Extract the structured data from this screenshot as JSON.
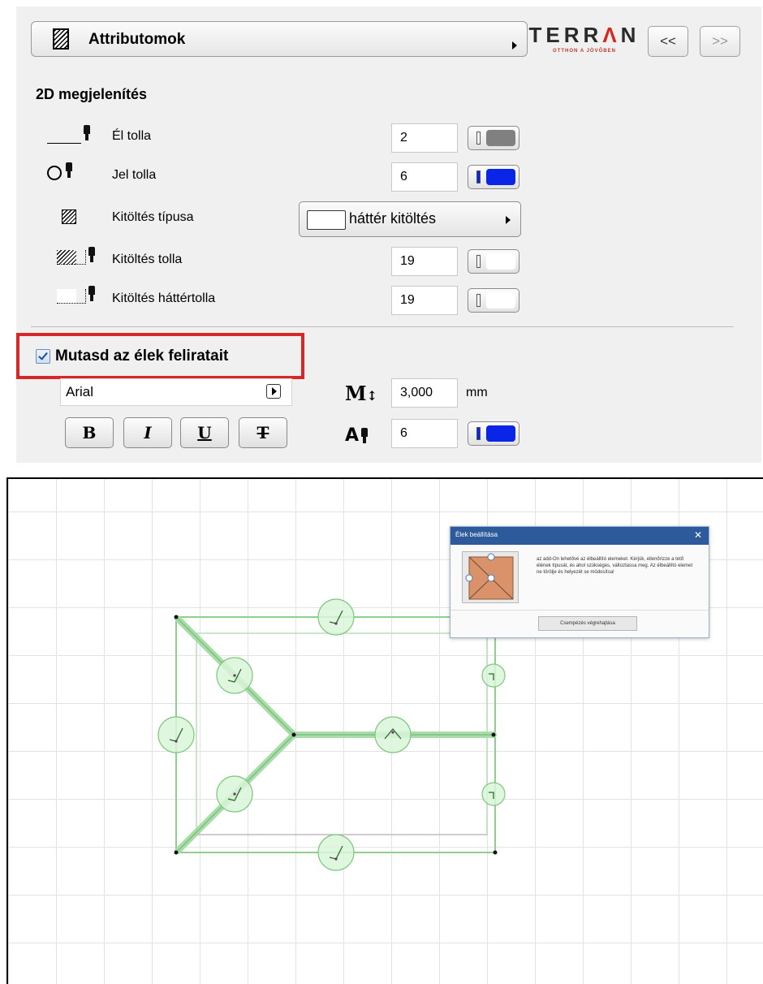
{
  "header": {
    "title": "Attributomok",
    "logo_text": "TERRAN",
    "logo_tagline": "OTTHON A JÖVŐBEN",
    "prev_label": "<<",
    "next_label": ">>"
  },
  "section_2d": {
    "title": "2D megjelenítés",
    "rows": [
      {
        "label": "Él tolla",
        "value": "2",
        "pen_color": "#808080"
      },
      {
        "label": "Jel tolla",
        "value": "6",
        "pen_color": "#0a24e8"
      },
      {
        "label": "Kitöltés típusa",
        "dropdown_value": "háttér kitöltés"
      },
      {
        "label": "Kitöltés tolla",
        "value": "19",
        "pen_color": "#ffffff"
      },
      {
        "label": "Kitöltés háttértolla",
        "value": "19",
        "pen_color": "#ffffff"
      }
    ]
  },
  "edge_labels": {
    "checkbox_label": "Mutasd az élek feliratait",
    "checked": true,
    "font_value": "Arial",
    "text_size_value": "3,000",
    "text_size_unit": "mm",
    "text_pen_value": "6",
    "text_pen_color": "#0a24e8",
    "style_buttons": [
      "B",
      "I",
      "U",
      "T"
    ]
  },
  "canvas": {
    "popup": {
      "title": "Élek beállítása",
      "description": "az add-On lehetővé az élbeállító elemeket. Kérjük, ellenőrizze a tető élének típusát, és ahol szükséges, változtassa meg. Az élbeállító elemet ne törölje és helyezét se módosítsa!",
      "button": "Csempézés végrehajtása"
    },
    "line_color": "#8fd08f",
    "marker_fill": "#d9f5d9",
    "marker_stroke": "#7fc77f"
  },
  "colors": {
    "highlight_border": "#d62828",
    "panel_background": "#f0f0f0",
    "popup_titlebar": "#2d5a9b"
  }
}
